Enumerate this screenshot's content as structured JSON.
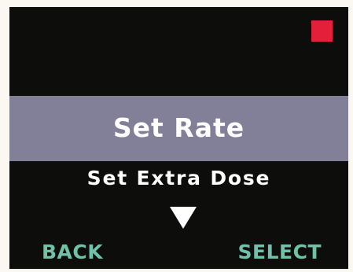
{
  "screen": {
    "status_indicator_color": "#e41f3a",
    "menu": {
      "selected_item": "Set Rate",
      "next_item": "Set Extra Dose",
      "scroll_indicator": "down-arrow-icon"
    },
    "softkeys": {
      "left_label": "BACK",
      "right_label": "SELECT"
    }
  }
}
